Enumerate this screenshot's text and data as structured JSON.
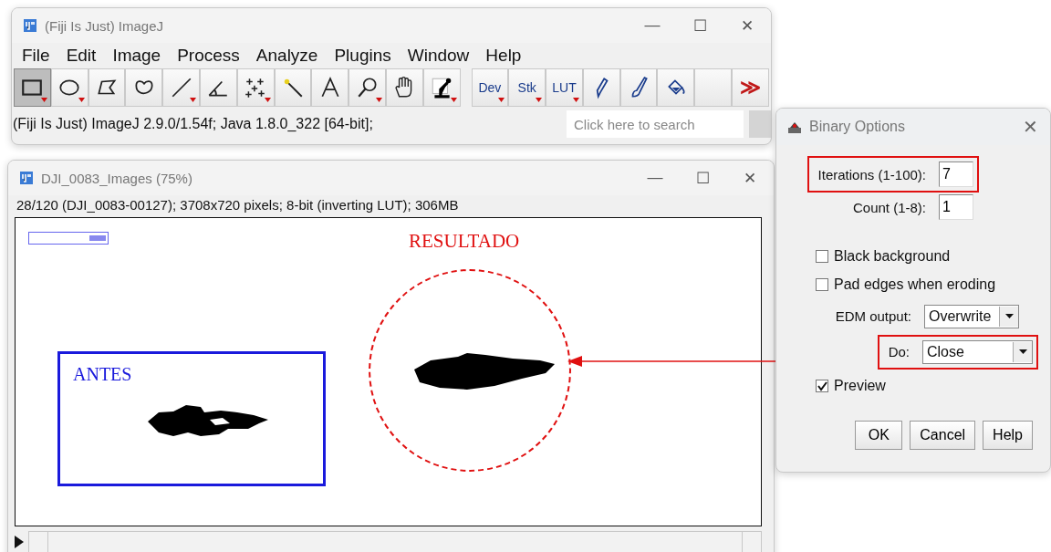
{
  "main_window": {
    "title": "(Fiji Is Just) ImageJ",
    "window_controls": [
      "—",
      "☐",
      "✕"
    ],
    "menus": [
      "File",
      "Edit",
      "Image",
      "Process",
      "Analyze",
      "Plugins",
      "Window",
      "Help"
    ],
    "tools": [
      {
        "selected": true,
        "dropdown": true
      },
      {
        "selected": false,
        "dropdown": true
      },
      {
        "selected": false,
        "dropdown": false
      },
      {
        "selected": false,
        "dropdown": false
      },
      {
        "selected": false,
        "dropdown": true
      },
      {
        "selected": false,
        "dropdown": false
      },
      {
        "selected": false,
        "dropdown": true
      },
      {
        "selected": false,
        "dropdown": false
      },
      {
        "selected": false,
        "dropdown": false
      },
      {
        "selected": false,
        "dropdown": true
      },
      {
        "selected": false,
        "dropdown": false
      },
      {
        "selected": false,
        "dropdown": true
      }
    ],
    "extra_tools": [
      {
        "label": "Dev",
        "dropdown": true
      },
      {
        "label": "Stk",
        "dropdown": true
      },
      {
        "label": "LUT",
        "dropdown": true
      },
      {
        "dropdown": false
      },
      {
        "dropdown": false
      },
      {
        "dropdown": false
      },
      {
        "dropdown": false
      },
      {
        "label": "≫",
        "dropdown": false
      }
    ],
    "status": "(Fiji Is Just) ImageJ 2.9.0/1.54f; Java 1.8.0_322 [64-bit];",
    "search": {
      "placeholder": "Click here to search"
    }
  },
  "image_window": {
    "title": "DJI_0083_Images (75%)",
    "window_controls": [
      "—",
      "☐",
      "✕"
    ],
    "info": "28/120 (DJI_0083-00127); 3708x720 pixels; 8-bit (inverting LUT); 306MB",
    "result_label": "RESULTADO",
    "before_label": "ANTES"
  },
  "dialog": {
    "title": "Binary Options",
    "close": "✕",
    "fields": [
      {
        "kind": "text",
        "label": "Iterations (1-100):",
        "value": "7",
        "highlighted": true
      },
      {
        "kind": "text",
        "label": "Count (1-8):",
        "value": "1",
        "highlighted": false
      }
    ],
    "checkboxes": [
      {
        "label": "Black background",
        "checked": false
      },
      {
        "label": "Pad edges when eroding",
        "checked": false
      }
    ],
    "choices": [
      {
        "kind": "dropdown",
        "label": "EDM output:",
        "value": "Overwrite",
        "highlighted": false
      },
      {
        "kind": "dropdown_wide",
        "label": "Do:",
        "value": "Close",
        "highlighted": true
      }
    ],
    "preview": {
      "label": "Preview",
      "checked": true
    },
    "buttons": [
      "OK",
      "Cancel",
      "Help"
    ]
  }
}
